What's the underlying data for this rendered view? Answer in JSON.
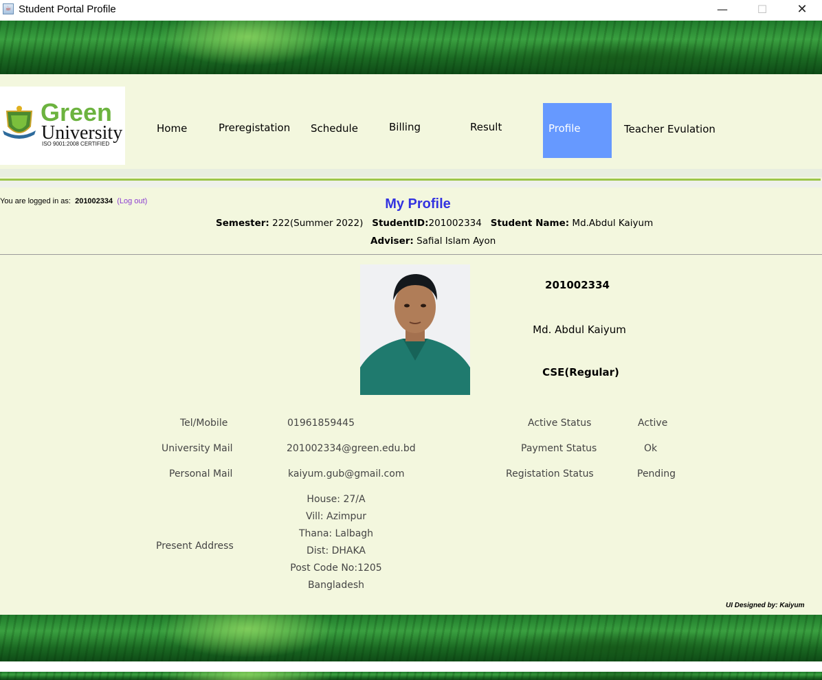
{
  "window": {
    "title": "Student Portal Profile",
    "minimize": "—",
    "maximize": "☐",
    "close": "✕"
  },
  "logo": {
    "word1": "Green",
    "word2": "University",
    "iso": "ISO 9001:2008 CERTIFIED"
  },
  "nav": {
    "home": "Home",
    "preregistation": "Preregistation",
    "schedule": "Schedule",
    "billing": "Billing",
    "result": "Result",
    "profile": "Profile",
    "teacher_evulation": "Teacher Evulation",
    "active_color": "#6699ff"
  },
  "login": {
    "prefix": "You are logged in as:",
    "user": "201002334",
    "logout": "(Log out)"
  },
  "header": {
    "title": "My Profile",
    "semester_label": "Semester:",
    "semester_value": "222(Summer 2022)",
    "student_id_label": "StudentID:",
    "student_id_value": "201002334",
    "student_name_label": "Student Name:",
    "student_name_value": "Md.Abdul Kaiyum",
    "adviser_label": "Adviser:",
    "adviser_value": "Safial Islam Ayon"
  },
  "summary": {
    "id": "201002334",
    "name": "Md. Abdul Kaiyum",
    "program": "CSE(Regular)"
  },
  "details": {
    "tel_label": "Tel/Mobile",
    "tel_value": "01961859445",
    "uni_mail_label": "University Mail",
    "uni_mail_value": "201002334@green.edu.bd",
    "personal_mail_label": "Personal Mail",
    "personal_mail_value": "kaiyum.gub@gmail.com",
    "active_status_label": "Active Status",
    "active_status_value": "Active",
    "payment_status_label": "Payment Status",
    "payment_status_value": "Ok",
    "reg_status_label": "Registation Status",
    "reg_status_value": "Pending",
    "address_label": "Present Address",
    "address_lines": [
      "House: 27/A",
      "Vill: Azimpur",
      "Thana: Lalbagh",
      "Dist: DHAKA",
      "Post Code No:1205",
      "Bangladesh"
    ]
  },
  "footer": {
    "credit": "UI Designed by: Kaiyum"
  }
}
